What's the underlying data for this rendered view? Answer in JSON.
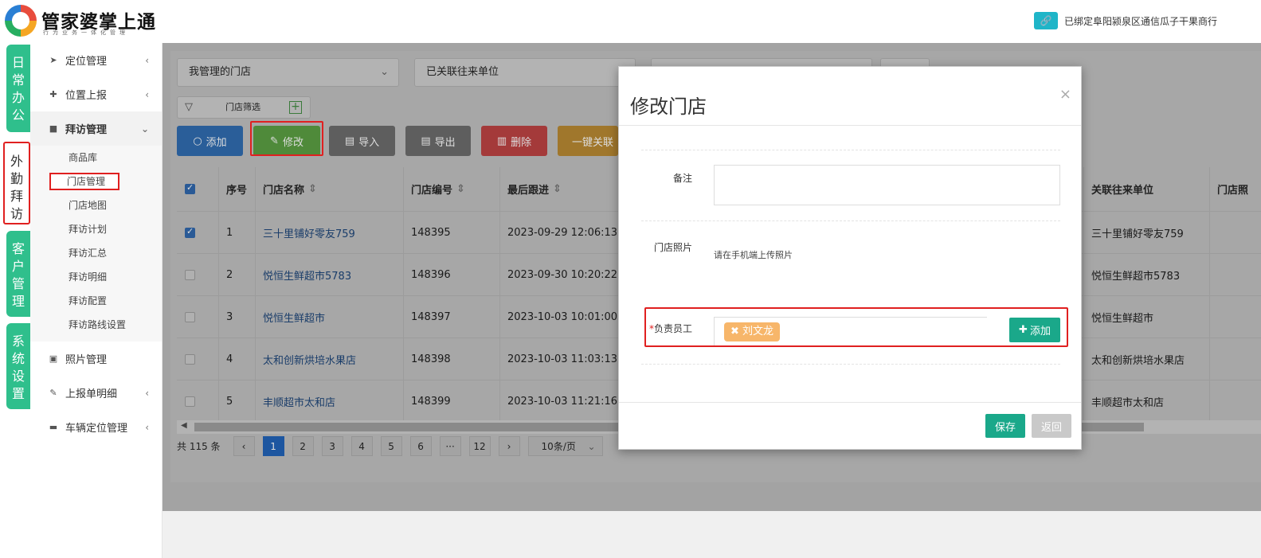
{
  "header": {
    "brand": "管家婆掌上通",
    "slogan": "行为业务一体化管理",
    "bind_text": "已绑定阜阳颍泉区通信瓜子干果商行"
  },
  "vtabs": [
    "日常办公",
    "外勤拜访",
    "客户管理",
    "系统设置"
  ],
  "menu": {
    "items": [
      {
        "label": "定位管理"
      },
      {
        "label": "位置上报"
      },
      {
        "label": "拜访管理"
      },
      {
        "label": "照片管理"
      },
      {
        "label": "上报单明细"
      },
      {
        "label": "车辆定位管理"
      }
    ],
    "sub": [
      "商品库",
      "门店管理",
      "门店地图",
      "拜访计划",
      "拜访汇总",
      "拜访明细",
      "拜访配置",
      "拜访路线设置"
    ]
  },
  "filters": {
    "store_scope": "我管理的门店",
    "linked_unit": "已关联往来单位",
    "store_filter": "门店筛选"
  },
  "toolbar": {
    "add": "添加",
    "edit": "修改",
    "import": "导入",
    "export": "导出",
    "delete": "删除",
    "link": "一键关联"
  },
  "table": {
    "headers": [
      "序号",
      "门店名称",
      "门店编号",
      "最后跟进",
      "关联往来单位",
      "门店照"
    ],
    "rows": [
      {
        "no": "1",
        "name": "三十里铺好零友759",
        "code": "148395",
        "last": "2023-09-29 12:06:13",
        "unit": "三十里铺好零友759",
        "checked": true
      },
      {
        "no": "2",
        "name": "悦恒生鲜超市5783",
        "code": "148396",
        "last": "2023-09-30 10:20:22",
        "unit": "悦恒生鲜超市5783",
        "checked": false
      },
      {
        "no": "3",
        "name": "悦恒生鲜超市",
        "code": "148397",
        "last": "2023-10-03 10:01:00",
        "unit": "悦恒生鲜超市",
        "checked": false
      },
      {
        "no": "4",
        "name": "太和创新烘培水果店",
        "code": "148398",
        "last": "2023-10-03 11:03:13",
        "unit": "太和创新烘培水果店",
        "checked": false
      },
      {
        "no": "5",
        "name": "丰顺超市太和店",
        "code": "148399",
        "last": "2023-10-03 11:21:16",
        "unit": "丰顺超市太和店",
        "checked": false
      }
    ]
  },
  "pager": {
    "total": "共 115 条",
    "pages": [
      "1",
      "2",
      "3",
      "4",
      "5",
      "6",
      "···",
      "12"
    ],
    "current": "1",
    "size": "10条/页"
  },
  "modal": {
    "title": "修改门店",
    "close": "×",
    "remark_label": "备注",
    "photo_label": "门店照片",
    "photo_hint": "请在手机端上传照片",
    "staff_required": "*",
    "staff_label": "负责员工",
    "staff_tag": "刘文龙",
    "staff_add": "添加",
    "save": "保存",
    "back": "返回"
  },
  "colors": {
    "accent_green": "#2fbf8c",
    "primary_blue": "#1d56a0",
    "tag_orange": "#f7b66a",
    "highlight_red": "#e02020"
  }
}
